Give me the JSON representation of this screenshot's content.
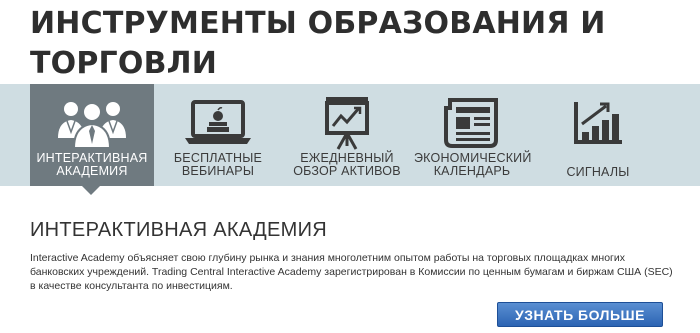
{
  "header": {
    "title_line1": "ИНСТРУМЕНТЫ ОБРАЗОВАНИЯ И",
    "title_line2": "ТОРГОВЛИ"
  },
  "tabs": [
    {
      "line1": "ИНТЕРАКТИВНАЯ",
      "line2": "АКАДЕМИЯ",
      "icon": "people-icon",
      "active": true
    },
    {
      "line1": "БЕСПЛАТНЫЕ",
      "line2": "ВЕБИНАРЫ",
      "icon": "laptop-icon",
      "active": false
    },
    {
      "line1": "ЕЖЕДНЕВНЫЙ",
      "line2": "ОБЗОР АКТИВОВ",
      "icon": "chart-board-icon",
      "active": false
    },
    {
      "line1": "ЭКОНОМИЧЕСКИЙ",
      "line2": "КАЛЕНДАРЬ",
      "icon": "newspaper-icon",
      "active": false
    },
    {
      "line1": "СИГНАЛЫ",
      "line2": "",
      "icon": "signal-bars-icon",
      "active": false
    }
  ],
  "section": {
    "heading": "ИНТЕРАКТИВНАЯ АКАДЕМИЯ",
    "description": "Interactive Academy объясняет свою глубину рынка и знания многолетним опытом работы на торговых площадках многих банковских учреждений. Trading Central Interactive Academy зарегистрирован в Комиссии по ценным бумагам и биржам США (SEC) в качестве консультанта по инвестициям.",
    "button_label": "УЗНАТЬ БОЛЬШЕ"
  },
  "colors": {
    "tab_band": "#cfdde2",
    "active_tab": "#6f7a80",
    "button": "#2c64b3",
    "title_text": "#2e2e2e"
  }
}
